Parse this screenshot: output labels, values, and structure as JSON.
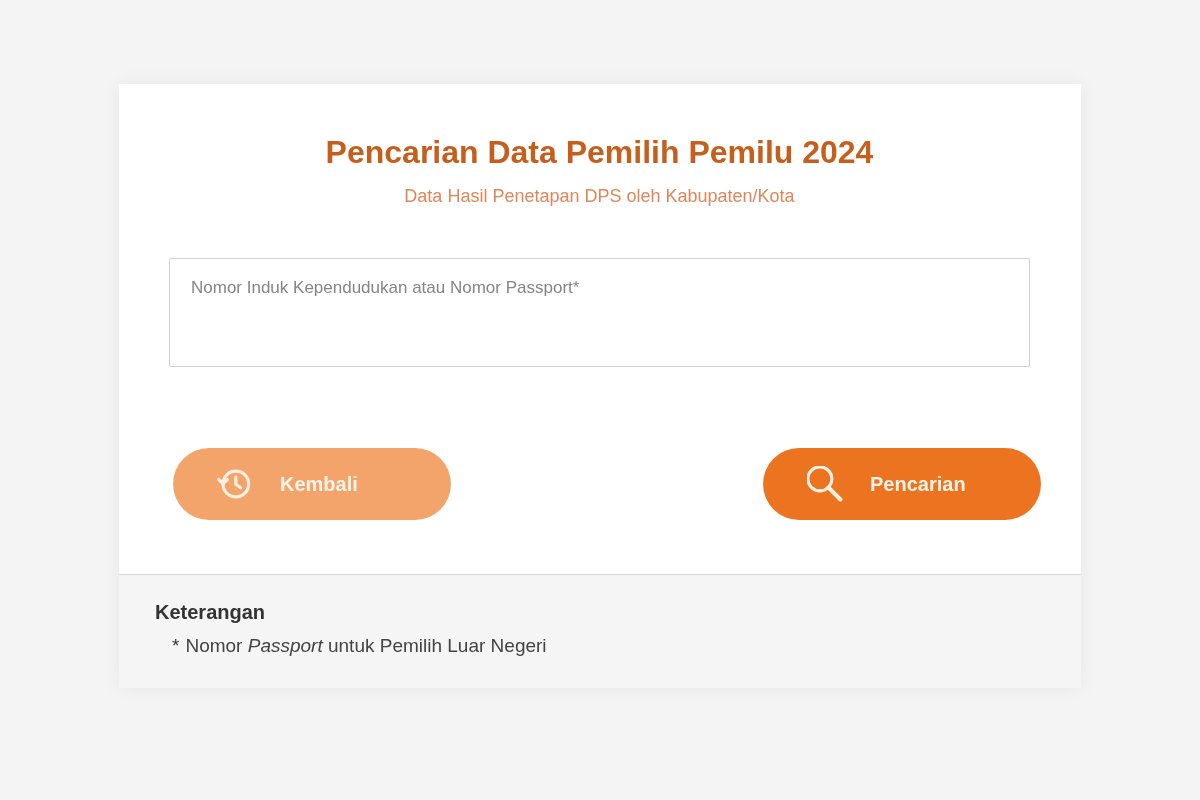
{
  "form": {
    "title": "Pencarian Data Pemilih Pemilu 2024",
    "subtitle": "Data Hasil Penetapan DPS oleh Kabupaten/Kota",
    "search_field": {
      "placeholder": "Nomor Induk Kependudukan atau Nomor Passport*"
    },
    "buttons": [
      {
        "label": "Kembali",
        "kind": "back"
      },
      {
        "label": "Pencarian",
        "kind": "search"
      }
    ]
  },
  "footer": {
    "heading": "Keterangan",
    "notes": [
      {
        "mark": "*",
        "text": "Nomor *Passport* untuk Pemilih Luar Negeri"
      }
    ]
  }
}
